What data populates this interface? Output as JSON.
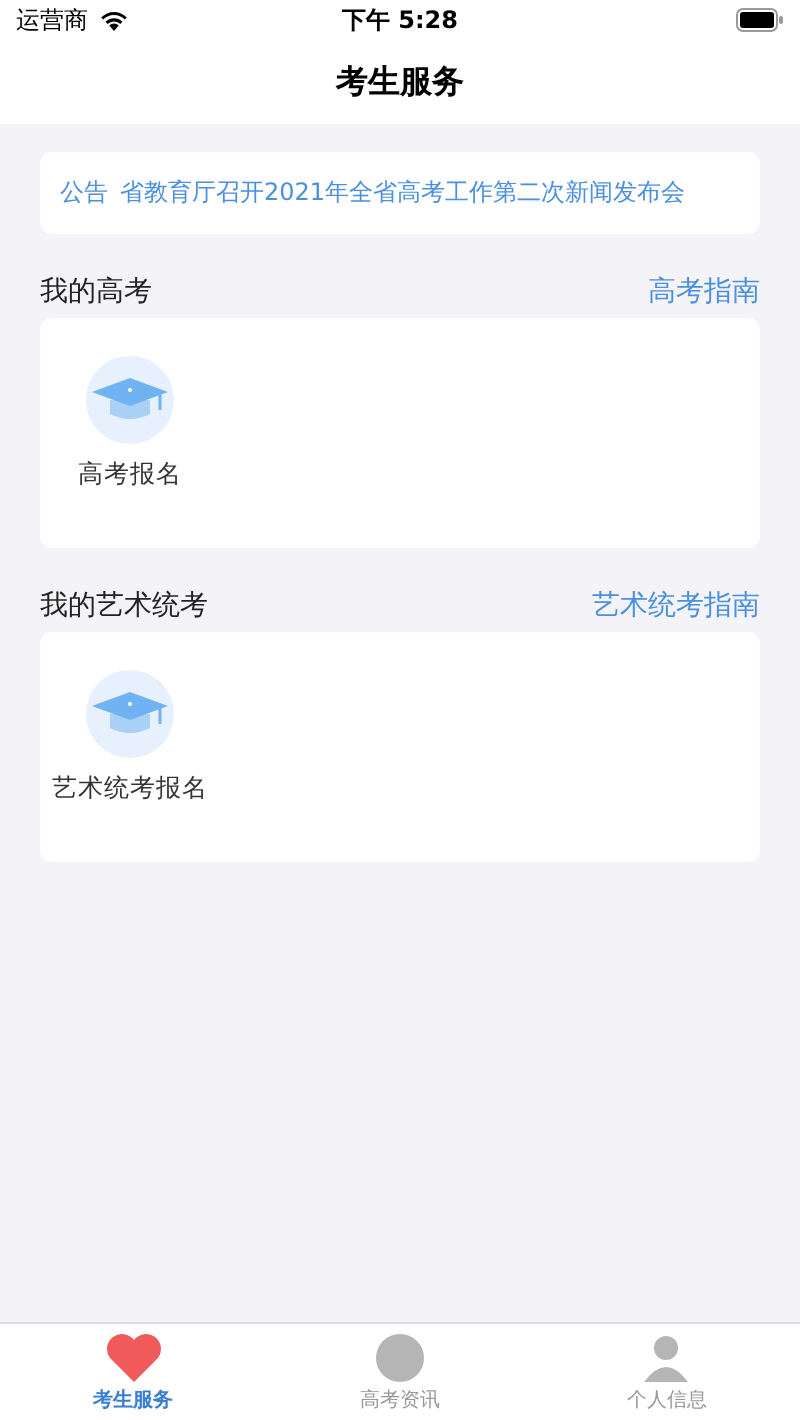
{
  "status_bar": {
    "carrier": "运营商",
    "time": "下午 5:28"
  },
  "nav": {
    "title": "考生服务"
  },
  "notice": {
    "tag": "公告",
    "text": "省教育厅召开2021年全省高考工作第二次新闻发布会"
  },
  "sections": [
    {
      "title": "我的高考",
      "link": "高考指南",
      "items": [
        {
          "label": "高考报名"
        }
      ]
    },
    {
      "title": "我的艺术统考",
      "link": "艺术统考指南",
      "items": [
        {
          "label": "艺术统考报名"
        }
      ]
    }
  ],
  "tabs": [
    {
      "label": "考生服务",
      "selected": true,
      "kind": "heart"
    },
    {
      "label": "高考资讯",
      "selected": false,
      "kind": "news"
    },
    {
      "label": "个人信息",
      "selected": false,
      "kind": "person"
    }
  ]
}
